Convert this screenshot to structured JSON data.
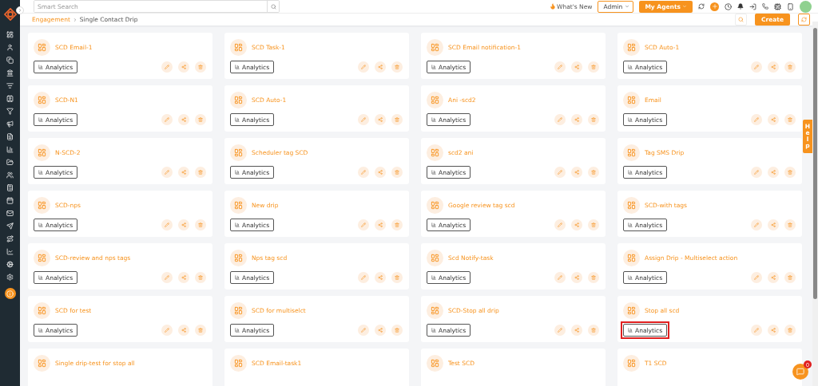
{
  "topbar": {
    "search": {
      "placeholder": "Smart Search"
    },
    "whats_new": "What's New",
    "role_select": {
      "value": "Admin"
    },
    "agents_button": "My Agents"
  },
  "breadcrumb": {
    "parent": "Engagement",
    "current": "Single Contact Drip"
  },
  "toolbar": {
    "create_button": "Create"
  },
  "cards": [
    {
      "title": "SCD Email-1",
      "analytics": "Analytics",
      "highlighted": false
    },
    {
      "title": "SCD Task-1",
      "analytics": "Analytics",
      "highlighted": false
    },
    {
      "title": "SCD Email notification-1",
      "analytics": "Analytics",
      "highlighted": false
    },
    {
      "title": "SCD Auto-1",
      "analytics": "Analytics",
      "highlighted": false
    },
    {
      "title": "SCD-N1",
      "analytics": "Analytics",
      "highlighted": false
    },
    {
      "title": "SCD Auto-1",
      "analytics": "Analytics",
      "highlighted": false
    },
    {
      "title": "Ani -scd2",
      "analytics": "Analytics",
      "highlighted": false
    },
    {
      "title": "Email",
      "analytics": "Analytics",
      "highlighted": false
    },
    {
      "title": "N-SCD-2",
      "analytics": "Analytics",
      "highlighted": false
    },
    {
      "title": "Scheduler tag SCD",
      "analytics": "Analytics",
      "highlighted": false
    },
    {
      "title": "scd2 ani",
      "analytics": "Analytics",
      "highlighted": false
    },
    {
      "title": "Tag SMS Drip",
      "analytics": "Analytics",
      "highlighted": false
    },
    {
      "title": "SCD-nps",
      "analytics": "Analytics",
      "highlighted": false
    },
    {
      "title": "New drip",
      "analytics": "Analytics",
      "highlighted": false
    },
    {
      "title": "Google review tag scd",
      "analytics": "Analytics",
      "highlighted": false
    },
    {
      "title": "SCD-with tags",
      "analytics": "Analytics",
      "highlighted": false
    },
    {
      "title": "SCD-review and nps tags",
      "analytics": "Analytics",
      "highlighted": false
    },
    {
      "title": "Nps tag scd",
      "analytics": "Analytics",
      "highlighted": false
    },
    {
      "title": "Scd Notify-task",
      "analytics": "Analytics",
      "highlighted": false
    },
    {
      "title": "Assign Drip - Multiselect action",
      "analytics": "Analytics",
      "highlighted": false
    },
    {
      "title": "SCD for test",
      "analytics": "Analytics",
      "highlighted": false
    },
    {
      "title": "SCD for multiselct",
      "analytics": "Analytics",
      "highlighted": false
    },
    {
      "title": "SCD-Stop all drip",
      "analytics": "Analytics",
      "highlighted": false
    },
    {
      "title": "Stop all scd",
      "analytics": "Analytics",
      "highlighted": true
    },
    {
      "title": "Single drip-test for stop all"
    },
    {
      "title": "SCD Email-task1"
    },
    {
      "title": "Test SCD"
    },
    {
      "title": "T1 SCD"
    }
  ],
  "help_tab": "Help",
  "chat": {
    "badge": "0"
  }
}
